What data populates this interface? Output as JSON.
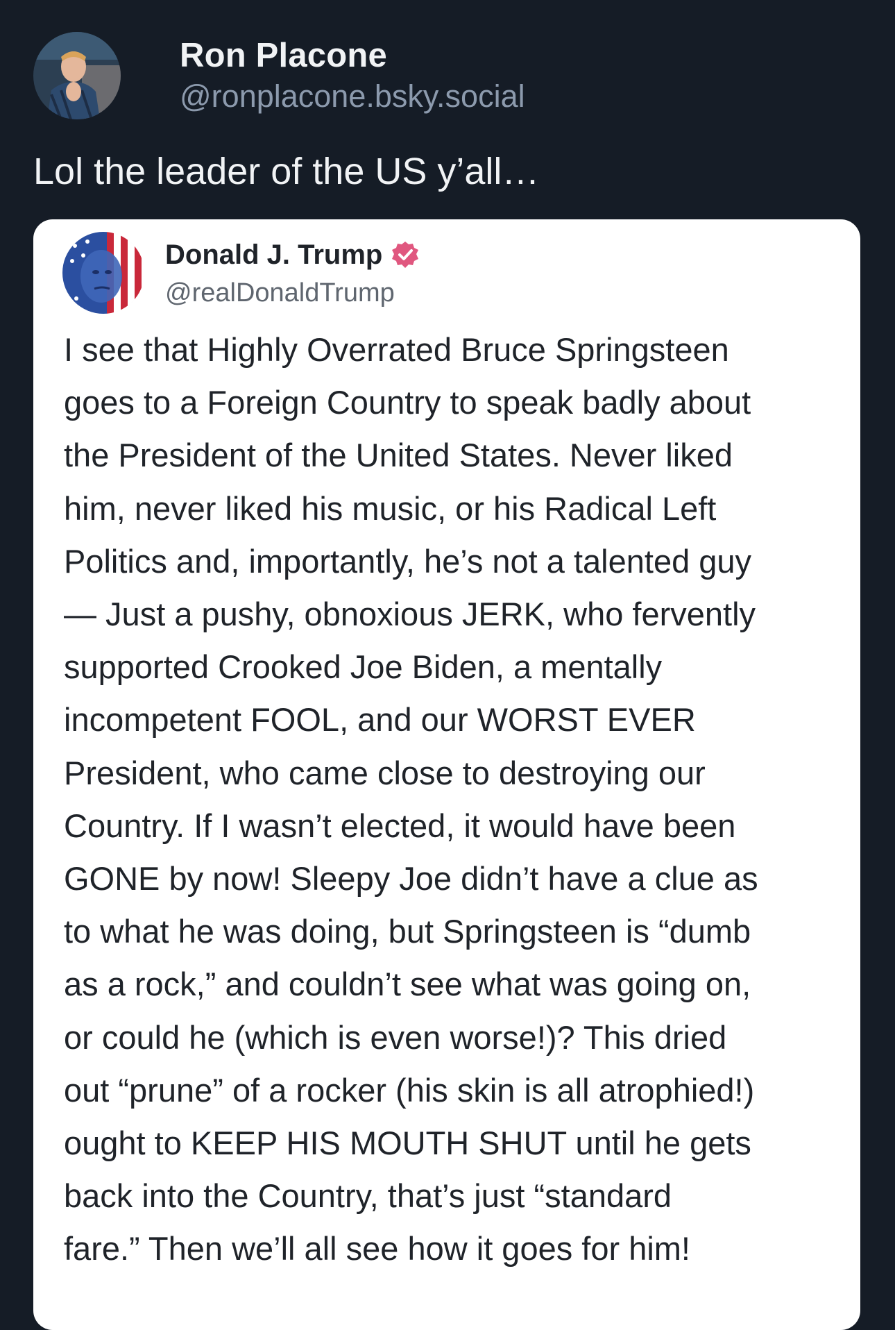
{
  "post": {
    "author_name": "Ron Placone",
    "author_handle": "@ronplacone.bsky.social",
    "text": "Lol the leader of the US y’all…"
  },
  "quoted": {
    "author_name": "Donald J. Trump",
    "author_handle": "@realDonaldTrump",
    "verified_icon": "verified-badge-icon",
    "body": "I see that Highly Overrated Bruce Springsteen\ngoes to a Foreign Country to speak badly about\nthe President of the United States. Never liked\nhim, never liked his music, or his Radical Left\nPolitics and, importantly, he’s not a talented guy\n— Just a pushy, obnoxious JERK, who fervently\nsupported Crooked Joe Biden, a mentally\nincompetent FOOL, and our WORST EVER\nPresident, who came close to destroying our\nCountry. If I wasn’t elected, it would have been\nGONE by now! Sleepy Joe didn’t have a clue as\nto what he was doing, but Springsteen is “dumb\nas a rock,” and couldn’t see what was going on,\nor could he (which is even worse!)? This dried\nout “prune” of a rocker (his skin is all atrophied!)\nought to KEEP HIS MOUTH SHUT until he gets\nback into the Country, that’s just “standard\nfare.” Then we’ll all see how it goes for him!"
  },
  "colors": {
    "background": "#151c26",
    "primary_text": "#f1f3f5",
    "secondary_text": "#8c9aad",
    "card_background": "#ffffff",
    "card_text": "#1f2329",
    "card_handle": "#5f666f",
    "verified_badge": "#e0577f"
  }
}
